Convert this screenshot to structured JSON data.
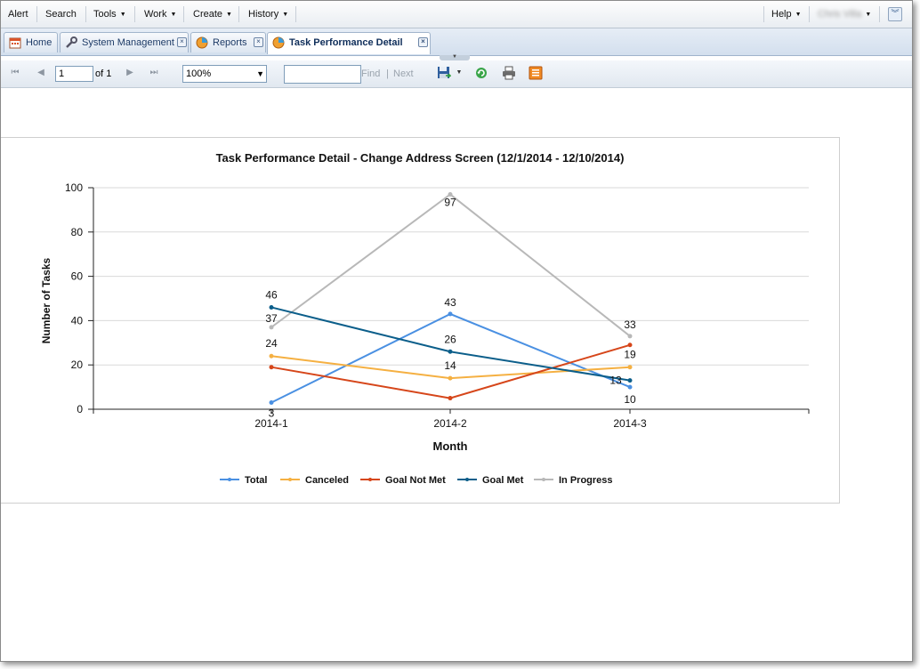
{
  "menubar": {
    "alert": "Alert",
    "search": "Search",
    "tools": "Tools",
    "work": "Work",
    "create": "Create",
    "history": "History",
    "help": "Help",
    "user": "Chris Villa"
  },
  "tabs": [
    {
      "label": "Home"
    },
    {
      "label": "System Management"
    },
    {
      "label": "Reports"
    },
    {
      "label": "Task Performance Detail"
    }
  ],
  "toolbar": {
    "page_value": "1",
    "of_label": "of 1",
    "zoom": "100%",
    "find_value": "",
    "find_label": "Find",
    "separator": "|",
    "next_label": "Next"
  },
  "chart_data": {
    "type": "line",
    "title": "Task Performance Detail - Change Address Screen (12/1/2014 - 12/10/2014)",
    "xlabel": "Month",
    "ylabel": "Number of Tasks",
    "categories": [
      "2014-1",
      "2014-2",
      "2014-3"
    ],
    "ylim": [
      0,
      100
    ],
    "yticks": [
      0,
      20,
      40,
      60,
      80,
      100
    ],
    "grid": true,
    "legend_position": "bottom",
    "series": [
      {
        "name": "Total",
        "color": "#4a90e2",
        "values": [
          3,
          43,
          10
        ],
        "labels": [
          "3",
          "43",
          "10"
        ]
      },
      {
        "name": "Canceled",
        "color": "#f5b042",
        "values": [
          24,
          14,
          19
        ],
        "labels": [
          "24",
          "14",
          "19"
        ]
      },
      {
        "name": "Goal Not Met",
        "color": "#d6461a",
        "values": [
          19,
          5,
          29
        ],
        "labels": [
          "",
          "",
          ""
        ]
      },
      {
        "name": "Goal Met",
        "color": "#0b5e8a",
        "values": [
          46,
          26,
          13
        ],
        "labels": [
          "46",
          "26",
          "13"
        ]
      },
      {
        "name": "In Progress",
        "color": "#b8b8b8",
        "values": [
          37,
          97,
          33
        ],
        "labels": [
          "37",
          "97",
          "33"
        ]
      }
    ]
  }
}
